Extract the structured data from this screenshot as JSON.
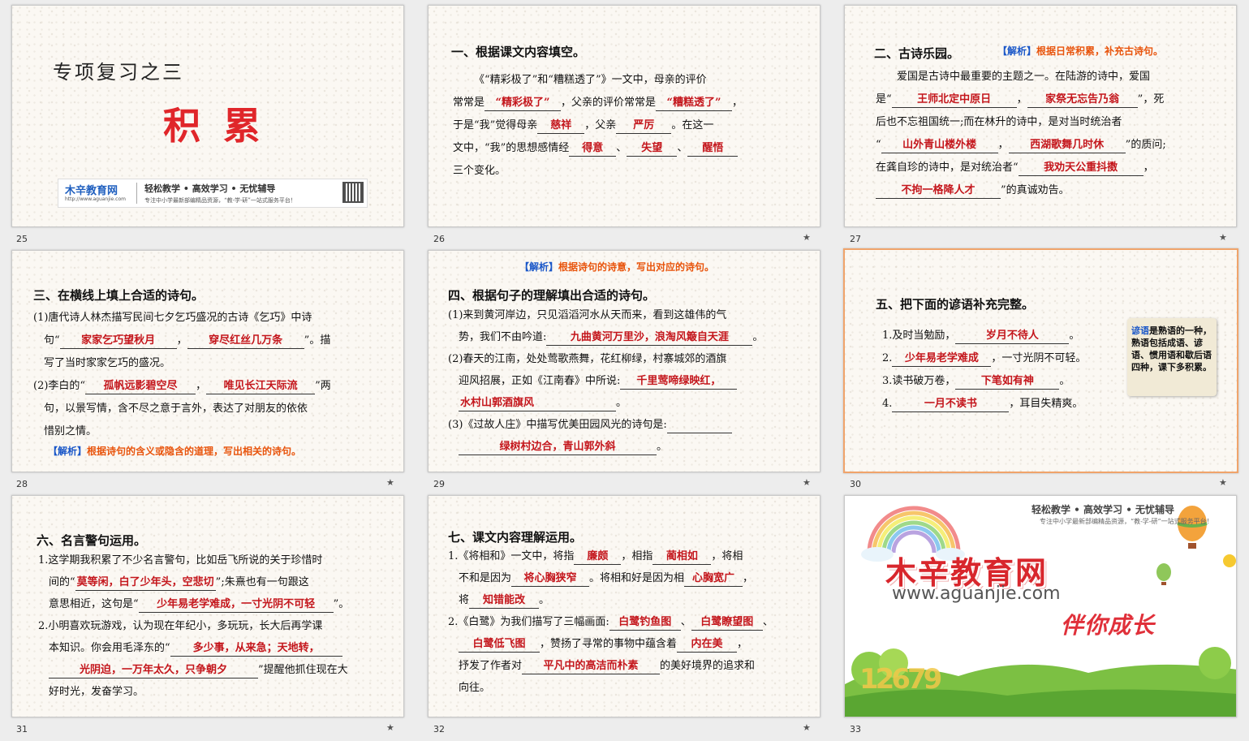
{
  "s25": {
    "num": "25",
    "subtitle": "专项复习之三",
    "title": "积 累",
    "logo": "木辛教育网",
    "logo_url": "http://www.aguanjie.com",
    "slogan": "轻松教学 • 高效学习 • 无忧辅导",
    "slogan2": "专注中小学最新部编精品资源，“教-学-研”一站式服务平台！"
  },
  "s26": {
    "num": "26",
    "heading": "一、根据课文内容填空。",
    "l1": "《“精彩极了”和“糟糕透了”》一文中，母亲的评价",
    "l2a": "常常是",
    "f1": "“精彩极了”",
    "l2b": "，父亲的评价常常是",
    "f2": "“糟糕透了”",
    "l2c": "，",
    "l3a": "于是“我”觉得母亲",
    "f3": "慈祥",
    "l3b": "，父亲",
    "f4": "严厉",
    "l3c": "。在这一",
    "l4a": "文中，“我”的思想感情经",
    "f5": "得意",
    "l4b": "、",
    "f6": "失望",
    "l4c": "、",
    "f7": "醒悟",
    "l5": "三个变化。"
  },
  "s27": {
    "num": "27",
    "heading": "二、古诗乐园。",
    "note_tag": "【解析】",
    "note": "根据日常积累，补充古诗句。",
    "l1": "爱国是古诗中最重要的主题之一。在陆游的诗中，爱国",
    "l2a": "是“",
    "f1": "王师北定中原日",
    "l2b": "，",
    "f2": "家祭无忘告乃翁",
    "l2c": "”，死",
    "l3": "后也不忘祖国统一;而在林升的诗中，是对当时统治者",
    "l4a": "“",
    "f3": "山外青山楼外楼",
    "l4b": "，",
    "f4": "西湖歌舞几时休",
    "l4c": "”的质问;",
    "l5a": "在龚自珍的诗中，是对统治者“",
    "f5": "我劝天公重抖擞",
    "l5b": "，",
    "f6": "不拘一格降人才",
    "l6b": "”的真诚劝告。"
  },
  "s28": {
    "num": "28",
    "heading": "三、在横线上填上合适的诗句。",
    "l1": "(1)唐代诗人林杰描写民间七夕乞巧盛况的古诗《乞巧》中诗",
    "l2a": "句“",
    "f1": "家家乞巧望秋月",
    "l2b": "，",
    "f2": "穿尽红丝几万条",
    "l2c": "”。描",
    "l3": "写了当时家家乞巧的盛况。",
    "l4a": "(2)李白的“",
    "f3": "孤帆远影碧空尽",
    "l4b": "，",
    "f4": "唯见长江天际流",
    "l4c": "”两",
    "l5": "句，以景写情，含不尽之意于言外，表达了对朋友的依依",
    "l6": "惜别之情。",
    "note_tag": "【解析】",
    "note": "根据诗句的含义或隐含的道理，写出相关的诗句。"
  },
  "s29": {
    "num": "29",
    "note_tag": "【解析】",
    "note": "根据诗句的诗意，写出对应的诗句。",
    "heading": "四、根据句子的理解填出合适的诗句。",
    "l1": "(1)来到黄河岸边，只见滔滔河水从天而来，看到这雄伟的气",
    "l2a": "势，我们不由吟道:",
    "f1": "九曲黄河万里沙，浪淘风簸自天涯",
    "l2b": "。",
    "l3": "(2)春天的江南，处处莺歌燕舞，花红柳绿，村寨城郊的酒旗",
    "l4a": "迎风招展，正如《江南春》中所说:",
    "f2": "千里莺啼绿映红，",
    "f3": "水村山郭酒旗风",
    "l5b": "。",
    "l6a": "(3)《过故人庄》中描写优美田园风光的诗句是:",
    "f4": "绿树村边合，青山郭外斜",
    "l7b": "。"
  },
  "s30": {
    "num": "30",
    "heading": "五、把下面的谚语补充完整。",
    "i1a": "1.及时当勉励，",
    "f1": "岁月不待人",
    "i1b": "。",
    "i2a": "2.",
    "f2": "少年易老学难成",
    "i2b": "，一寸光阴不可轻。",
    "i3a": "3.读书破万卷，",
    "f3": "下笔如有神",
    "i3b": "。",
    "i4a": "4.",
    "f4": "一月不读书",
    "i4b": "，耳目失精爽。",
    "side_tag": "谚语",
    "side": "是熟语的一种，熟语包括成语、谚语、惯用语和歇后语四种，课下多积累。"
  },
  "s31": {
    "num": "31",
    "heading": "六、名言警句运用。",
    "l1": "1.这学期我积累了不少名言警句，比如岳飞所说的关于珍惜时",
    "l2a": "间的“",
    "f1": "莫等闲，白了少年头，空悲切",
    "l2b": "”;朱熹也有一句跟这",
    "l3a": "意思相近，这句是“",
    "f2": "少年易老学难成，一寸光阴不可轻",
    "l3b": "”。",
    "l4": "2.小明喜欢玩游戏，认为现在年纪小，多玩玩，长大后再学课",
    "l5a": "本知识。你会用毛泽东的“",
    "f3": "多少事，从来急；天地转，",
    "f4": "光阴迫，一万年太久，只争朝夕",
    "l6b": "”提醒他抓住现在大",
    "l7": "好时光，发奋学习。"
  },
  "s32": {
    "num": "32",
    "heading": "七、课文内容理解运用。",
    "l1a": "1.《将相和》一文中，将指",
    "f1": "廉颇",
    "l1b": "，相指",
    "f2": "蔺相如",
    "l1c": "，将相",
    "l2a": "不和是因为",
    "f3": "将心胸狭窄",
    "l2b": "。将相和好是因为相",
    "f4": "心胸宽广",
    "l2c": "，",
    "l3a": "将",
    "f5": "知错能改",
    "l3b": "。",
    "l4a": "2.《白鹭》为我们描写了三幅画面:",
    "f6": "白鹭钓鱼图",
    "l4b": "、",
    "f7": "白鹭瞭望图",
    "l4c": "、",
    "f8": "白鹭低飞图",
    "l5b": "，赞扬了寻常的事物中蕴含着",
    "f9": "内在美",
    "l5c": "，",
    "l6a": "抒发了作者对",
    "f10": "平凡中的高洁而朴素",
    "l6b": "的美好境界的追求和",
    "l7": "向往。"
  },
  "s33": {
    "num": "33",
    "slogan": "轻松教学 • 高效学习 • 无忧辅导",
    "slogan2": "专注中小学最新部编精品资源，“教-学-研”一站式服务平台！",
    "brand": "木辛教育网",
    "url": "www.aguanjie.com",
    "motto": "伴你成长",
    "digits": "12679"
  },
  "colors": {
    "accent_red": "#c4161c",
    "note_orange": "#e8540c",
    "note_blue": "#1a57c8",
    "selected_border": "#f0a46b"
  }
}
